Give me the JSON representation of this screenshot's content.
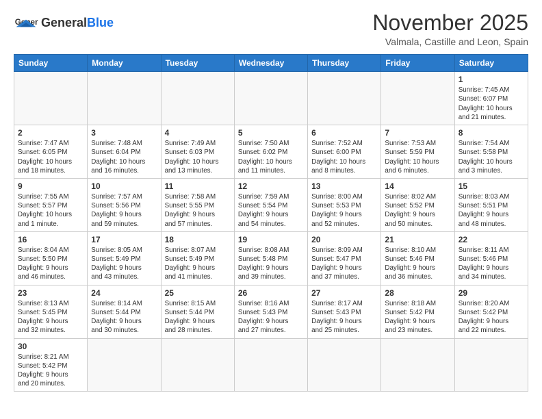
{
  "header": {
    "logo_general": "General",
    "logo_blue": "Blue",
    "month_title": "November 2025",
    "location": "Valmala, Castille and Leon, Spain"
  },
  "weekdays": [
    "Sunday",
    "Monday",
    "Tuesday",
    "Wednesday",
    "Thursday",
    "Friday",
    "Saturday"
  ],
  "days": [
    {
      "num": "",
      "info": ""
    },
    {
      "num": "",
      "info": ""
    },
    {
      "num": "",
      "info": ""
    },
    {
      "num": "",
      "info": ""
    },
    {
      "num": "",
      "info": ""
    },
    {
      "num": "",
      "info": ""
    },
    {
      "num": "1",
      "info": "Sunrise: 7:45 AM\nSunset: 6:07 PM\nDaylight: 10 hours\nand 21 minutes."
    },
    {
      "num": "2",
      "info": "Sunrise: 7:47 AM\nSunset: 6:05 PM\nDaylight: 10 hours\nand 18 minutes."
    },
    {
      "num": "3",
      "info": "Sunrise: 7:48 AM\nSunset: 6:04 PM\nDaylight: 10 hours\nand 16 minutes."
    },
    {
      "num": "4",
      "info": "Sunrise: 7:49 AM\nSunset: 6:03 PM\nDaylight: 10 hours\nand 13 minutes."
    },
    {
      "num": "5",
      "info": "Sunrise: 7:50 AM\nSunset: 6:02 PM\nDaylight: 10 hours\nand 11 minutes."
    },
    {
      "num": "6",
      "info": "Sunrise: 7:52 AM\nSunset: 6:00 PM\nDaylight: 10 hours\nand 8 minutes."
    },
    {
      "num": "7",
      "info": "Sunrise: 7:53 AM\nSunset: 5:59 PM\nDaylight: 10 hours\nand 6 minutes."
    },
    {
      "num": "8",
      "info": "Sunrise: 7:54 AM\nSunset: 5:58 PM\nDaylight: 10 hours\nand 3 minutes."
    },
    {
      "num": "9",
      "info": "Sunrise: 7:55 AM\nSunset: 5:57 PM\nDaylight: 10 hours\nand 1 minute."
    },
    {
      "num": "10",
      "info": "Sunrise: 7:57 AM\nSunset: 5:56 PM\nDaylight: 9 hours\nand 59 minutes."
    },
    {
      "num": "11",
      "info": "Sunrise: 7:58 AM\nSunset: 5:55 PM\nDaylight: 9 hours\nand 57 minutes."
    },
    {
      "num": "12",
      "info": "Sunrise: 7:59 AM\nSunset: 5:54 PM\nDaylight: 9 hours\nand 54 minutes."
    },
    {
      "num": "13",
      "info": "Sunrise: 8:00 AM\nSunset: 5:53 PM\nDaylight: 9 hours\nand 52 minutes."
    },
    {
      "num": "14",
      "info": "Sunrise: 8:02 AM\nSunset: 5:52 PM\nDaylight: 9 hours\nand 50 minutes."
    },
    {
      "num": "15",
      "info": "Sunrise: 8:03 AM\nSunset: 5:51 PM\nDaylight: 9 hours\nand 48 minutes."
    },
    {
      "num": "16",
      "info": "Sunrise: 8:04 AM\nSunset: 5:50 PM\nDaylight: 9 hours\nand 46 minutes."
    },
    {
      "num": "17",
      "info": "Sunrise: 8:05 AM\nSunset: 5:49 PM\nDaylight: 9 hours\nand 43 minutes."
    },
    {
      "num": "18",
      "info": "Sunrise: 8:07 AM\nSunset: 5:49 PM\nDaylight: 9 hours\nand 41 minutes."
    },
    {
      "num": "19",
      "info": "Sunrise: 8:08 AM\nSunset: 5:48 PM\nDaylight: 9 hours\nand 39 minutes."
    },
    {
      "num": "20",
      "info": "Sunrise: 8:09 AM\nSunset: 5:47 PM\nDaylight: 9 hours\nand 37 minutes."
    },
    {
      "num": "21",
      "info": "Sunrise: 8:10 AM\nSunset: 5:46 PM\nDaylight: 9 hours\nand 36 minutes."
    },
    {
      "num": "22",
      "info": "Sunrise: 8:11 AM\nSunset: 5:46 PM\nDaylight: 9 hours\nand 34 minutes."
    },
    {
      "num": "23",
      "info": "Sunrise: 8:13 AM\nSunset: 5:45 PM\nDaylight: 9 hours\nand 32 minutes."
    },
    {
      "num": "24",
      "info": "Sunrise: 8:14 AM\nSunset: 5:44 PM\nDaylight: 9 hours\nand 30 minutes."
    },
    {
      "num": "25",
      "info": "Sunrise: 8:15 AM\nSunset: 5:44 PM\nDaylight: 9 hours\nand 28 minutes."
    },
    {
      "num": "26",
      "info": "Sunrise: 8:16 AM\nSunset: 5:43 PM\nDaylight: 9 hours\nand 27 minutes."
    },
    {
      "num": "27",
      "info": "Sunrise: 8:17 AM\nSunset: 5:43 PM\nDaylight: 9 hours\nand 25 minutes."
    },
    {
      "num": "28",
      "info": "Sunrise: 8:18 AM\nSunset: 5:42 PM\nDaylight: 9 hours\nand 23 minutes."
    },
    {
      "num": "29",
      "info": "Sunrise: 8:20 AM\nSunset: 5:42 PM\nDaylight: 9 hours\nand 22 minutes."
    },
    {
      "num": "30",
      "info": "Sunrise: 8:21 AM\nSunset: 5:42 PM\nDaylight: 9 hours\nand 20 minutes."
    },
    {
      "num": "",
      "info": ""
    },
    {
      "num": "",
      "info": ""
    },
    {
      "num": "",
      "info": ""
    },
    {
      "num": "",
      "info": ""
    },
    {
      "num": "",
      "info": ""
    },
    {
      "num": "",
      "info": ""
    }
  ]
}
